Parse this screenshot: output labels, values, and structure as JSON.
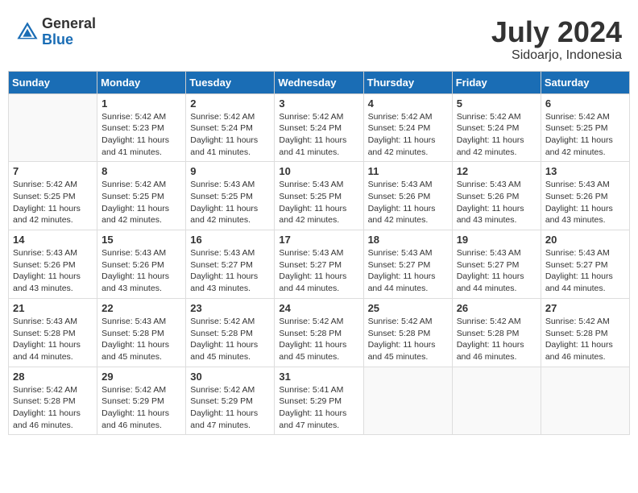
{
  "header": {
    "logo_general": "General",
    "logo_blue": "Blue",
    "month_year": "July 2024",
    "location": "Sidoarjo, Indonesia"
  },
  "weekdays": [
    "Sunday",
    "Monday",
    "Tuesday",
    "Wednesday",
    "Thursday",
    "Friday",
    "Saturday"
  ],
  "weeks": [
    [
      {
        "day": "",
        "info": ""
      },
      {
        "day": "1",
        "info": "Sunrise: 5:42 AM\nSunset: 5:23 PM\nDaylight: 11 hours\nand 41 minutes."
      },
      {
        "day": "2",
        "info": "Sunrise: 5:42 AM\nSunset: 5:24 PM\nDaylight: 11 hours\nand 41 minutes."
      },
      {
        "day": "3",
        "info": "Sunrise: 5:42 AM\nSunset: 5:24 PM\nDaylight: 11 hours\nand 41 minutes."
      },
      {
        "day": "4",
        "info": "Sunrise: 5:42 AM\nSunset: 5:24 PM\nDaylight: 11 hours\nand 42 minutes."
      },
      {
        "day": "5",
        "info": "Sunrise: 5:42 AM\nSunset: 5:24 PM\nDaylight: 11 hours\nand 42 minutes."
      },
      {
        "day": "6",
        "info": "Sunrise: 5:42 AM\nSunset: 5:25 PM\nDaylight: 11 hours\nand 42 minutes."
      }
    ],
    [
      {
        "day": "7",
        "info": "Sunrise: 5:42 AM\nSunset: 5:25 PM\nDaylight: 11 hours\nand 42 minutes."
      },
      {
        "day": "8",
        "info": "Sunrise: 5:42 AM\nSunset: 5:25 PM\nDaylight: 11 hours\nand 42 minutes."
      },
      {
        "day": "9",
        "info": "Sunrise: 5:43 AM\nSunset: 5:25 PM\nDaylight: 11 hours\nand 42 minutes."
      },
      {
        "day": "10",
        "info": "Sunrise: 5:43 AM\nSunset: 5:25 PM\nDaylight: 11 hours\nand 42 minutes."
      },
      {
        "day": "11",
        "info": "Sunrise: 5:43 AM\nSunset: 5:26 PM\nDaylight: 11 hours\nand 42 minutes."
      },
      {
        "day": "12",
        "info": "Sunrise: 5:43 AM\nSunset: 5:26 PM\nDaylight: 11 hours\nand 43 minutes."
      },
      {
        "day": "13",
        "info": "Sunrise: 5:43 AM\nSunset: 5:26 PM\nDaylight: 11 hours\nand 43 minutes."
      }
    ],
    [
      {
        "day": "14",
        "info": "Sunrise: 5:43 AM\nSunset: 5:26 PM\nDaylight: 11 hours\nand 43 minutes."
      },
      {
        "day": "15",
        "info": "Sunrise: 5:43 AM\nSunset: 5:26 PM\nDaylight: 11 hours\nand 43 minutes."
      },
      {
        "day": "16",
        "info": "Sunrise: 5:43 AM\nSunset: 5:27 PM\nDaylight: 11 hours\nand 43 minutes."
      },
      {
        "day": "17",
        "info": "Sunrise: 5:43 AM\nSunset: 5:27 PM\nDaylight: 11 hours\nand 44 minutes."
      },
      {
        "day": "18",
        "info": "Sunrise: 5:43 AM\nSunset: 5:27 PM\nDaylight: 11 hours\nand 44 minutes."
      },
      {
        "day": "19",
        "info": "Sunrise: 5:43 AM\nSunset: 5:27 PM\nDaylight: 11 hours\nand 44 minutes."
      },
      {
        "day": "20",
        "info": "Sunrise: 5:43 AM\nSunset: 5:27 PM\nDaylight: 11 hours\nand 44 minutes."
      }
    ],
    [
      {
        "day": "21",
        "info": "Sunrise: 5:43 AM\nSunset: 5:28 PM\nDaylight: 11 hours\nand 44 minutes."
      },
      {
        "day": "22",
        "info": "Sunrise: 5:43 AM\nSunset: 5:28 PM\nDaylight: 11 hours\nand 45 minutes."
      },
      {
        "day": "23",
        "info": "Sunrise: 5:42 AM\nSunset: 5:28 PM\nDaylight: 11 hours\nand 45 minutes."
      },
      {
        "day": "24",
        "info": "Sunrise: 5:42 AM\nSunset: 5:28 PM\nDaylight: 11 hours\nand 45 minutes."
      },
      {
        "day": "25",
        "info": "Sunrise: 5:42 AM\nSunset: 5:28 PM\nDaylight: 11 hours\nand 45 minutes."
      },
      {
        "day": "26",
        "info": "Sunrise: 5:42 AM\nSunset: 5:28 PM\nDaylight: 11 hours\nand 46 minutes."
      },
      {
        "day": "27",
        "info": "Sunrise: 5:42 AM\nSunset: 5:28 PM\nDaylight: 11 hours\nand 46 minutes."
      }
    ],
    [
      {
        "day": "28",
        "info": "Sunrise: 5:42 AM\nSunset: 5:28 PM\nDaylight: 11 hours\nand 46 minutes."
      },
      {
        "day": "29",
        "info": "Sunrise: 5:42 AM\nSunset: 5:29 PM\nDaylight: 11 hours\nand 46 minutes."
      },
      {
        "day": "30",
        "info": "Sunrise: 5:42 AM\nSunset: 5:29 PM\nDaylight: 11 hours\nand 47 minutes."
      },
      {
        "day": "31",
        "info": "Sunrise: 5:41 AM\nSunset: 5:29 PM\nDaylight: 11 hours\nand 47 minutes."
      },
      {
        "day": "",
        "info": ""
      },
      {
        "day": "",
        "info": ""
      },
      {
        "day": "",
        "info": ""
      }
    ]
  ]
}
